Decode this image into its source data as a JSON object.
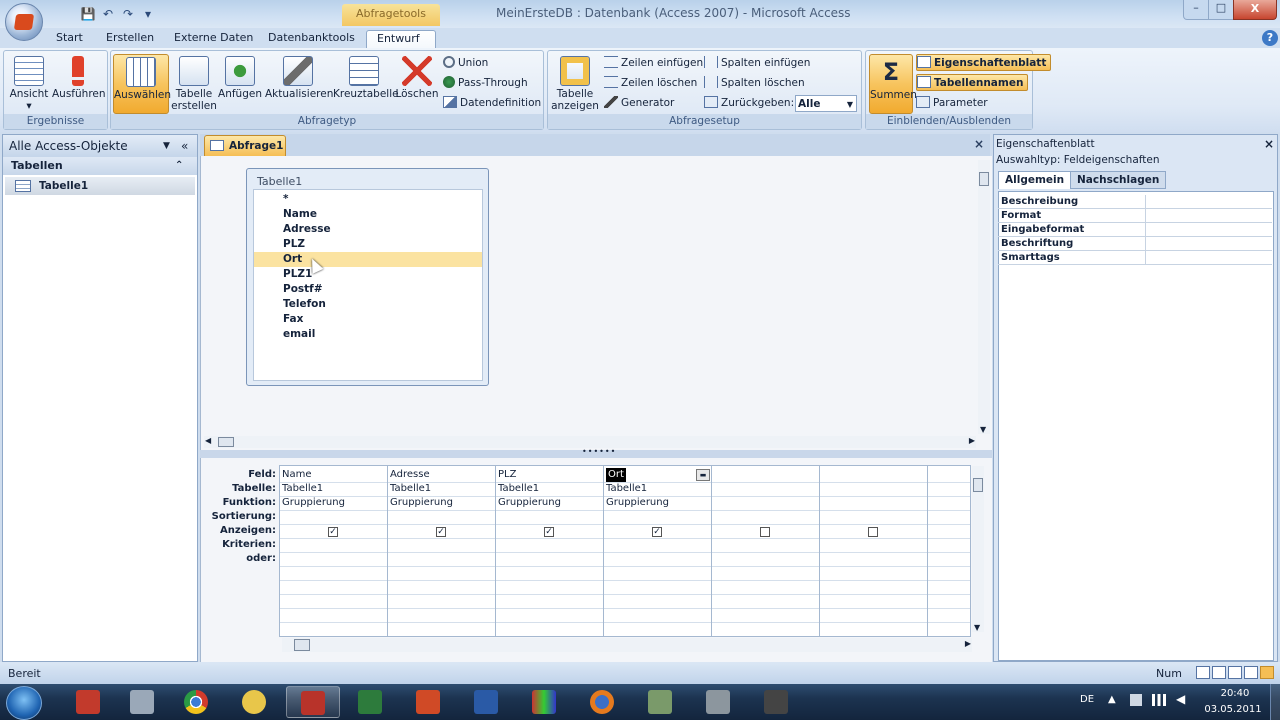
{
  "window": {
    "title": "MeinErsteDB : Datenbank (Access 2007) - Microsoft Access",
    "context_tab": "Abfragetools",
    "controls": {
      "minimize": "–",
      "maximize": "□",
      "close": "X"
    }
  },
  "ribbon": {
    "tabs": [
      "Start",
      "Erstellen",
      "Externe Daten",
      "Datenbanktools",
      "Entwurf"
    ],
    "active_tab": "Entwurf",
    "groups": {
      "ergebnisse": {
        "label": "Ergebnisse",
        "ansicht": "Ansicht",
        "ausfuehren": "Ausführen"
      },
      "abfragetyp": {
        "label": "Abfragetyp",
        "auswaehlen": "Auswählen",
        "tabelle_erstellen": "Tabelle erstellen",
        "anfuegen": "Anfügen",
        "aktualisieren": "Aktualisieren",
        "kreuztabelle": "Kreuztabelle",
        "loeschen": "Löschen",
        "union": "Union",
        "pass_through": "Pass-Through",
        "datendefinition": "Datendefinition"
      },
      "abfragesetup": {
        "label": "Abfragesetup",
        "tabelle_anzeigen": "Tabelle anzeigen",
        "zeilen_einfuegen": "Zeilen einfügen",
        "zeilen_loeschen": "Zeilen löschen",
        "generator": "Generator",
        "spalten_einfuegen": "Spalten einfügen",
        "spalten_loeschen": "Spalten löschen",
        "zurueckgeben": "Zurückgeben:",
        "zurueckgeben_value": "Alle"
      },
      "einblenden": {
        "label": "Einblenden/Ausblenden",
        "summen": "Summen",
        "eigenschaftenblatt": "Eigenschaftenblatt",
        "tabellennamen": "Tabellennamen",
        "parameter": "Parameter"
      }
    }
  },
  "nav": {
    "header": "Alle Access-Objekte",
    "group": "Tabellen",
    "items": [
      "Tabelle1"
    ]
  },
  "document": {
    "tab": "Abfrage1",
    "field_list": {
      "title": "Tabelle1",
      "fields": [
        "*",
        "Name",
        "Adresse",
        "PLZ",
        "Ort",
        "PLZ1",
        "Postf#",
        "Telefon",
        "Fax",
        "email"
      ],
      "selected": "Ort"
    },
    "grid": {
      "row_labels": [
        "Feld:",
        "Tabelle:",
        "Funktion:",
        "Sortierung:",
        "Anzeigen:",
        "Kriterien:",
        "oder:"
      ],
      "columns": [
        {
          "feld": "Name",
          "tabelle": "Tabelle1",
          "funktion": "Gruppierung",
          "anzeigen": true
        },
        {
          "feld": "Adresse",
          "tabelle": "Tabelle1",
          "funktion": "Gruppierung",
          "anzeigen": true
        },
        {
          "feld": "PLZ",
          "tabelle": "Tabelle1",
          "funktion": "Gruppierung",
          "anzeigen": true
        },
        {
          "feld": "Ort",
          "tabelle": "Tabelle1",
          "funktion": "Gruppierung",
          "anzeigen": true
        },
        {
          "feld": "",
          "tabelle": "",
          "funktion": "",
          "anzeigen": false
        },
        {
          "feld": "",
          "tabelle": "",
          "funktion": "",
          "anzeigen": false
        }
      ]
    }
  },
  "property_sheet": {
    "title": "Eigenschaftenblatt",
    "selection_type": "Auswahltyp:  Feldeigenschaften",
    "tabs": [
      "Allgemein",
      "Nachschlagen"
    ],
    "active_tab": "Allgemein",
    "properties": [
      "Beschreibung",
      "Format",
      "Eingabeformat",
      "Beschriftung",
      "Smarttags"
    ]
  },
  "status": {
    "left": "Bereit",
    "num": "Num"
  },
  "taskbar": {
    "language": "DE",
    "time": "20:40",
    "date": "03.05.2011"
  },
  "colors": {
    "accent": "#f5be55",
    "ribbon": "#dfe9f6",
    "taskbar": "#1c3350"
  }
}
